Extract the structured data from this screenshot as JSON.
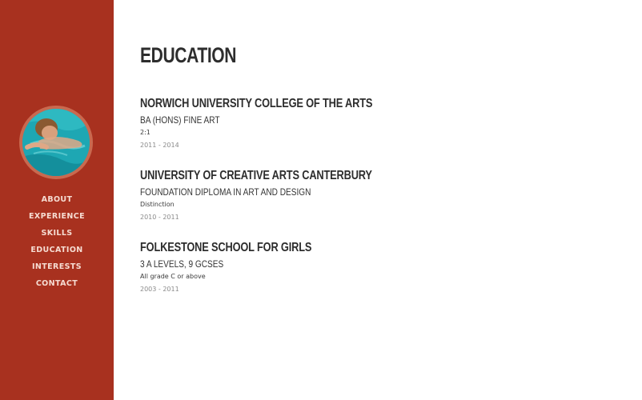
{
  "sidebar": {
    "avatar_alt": "profile photo",
    "nav": [
      "ABOUT",
      "EXPERIENCE",
      "SKILLS",
      "EDUCATION",
      "INTERESTS",
      "CONTACT"
    ],
    "background_color": "#a8311f"
  },
  "main": {
    "title": "EDUCATION",
    "entries": [
      {
        "school": "NORWICH UNIVERSITY COLLEGE OF THE ARTS",
        "degree": "BA (HONS) FINE ART",
        "grade": "2:1",
        "years": "2011 - 2014"
      },
      {
        "school": "UNIVERSITY OF CREATIVE ARTS CANTERBURY",
        "degree": "FOUNDATION DIPLOMA IN ART AND DESIGN",
        "grade": "Distinction",
        "years": "2010 - 2011"
      },
      {
        "school": "FOLKESTONE SCHOOL FOR GIRLS",
        "degree": "3 A LEVELS, 9 GCSES",
        "grade": "All grade C or above",
        "years": "2003 - 2011"
      }
    ]
  }
}
